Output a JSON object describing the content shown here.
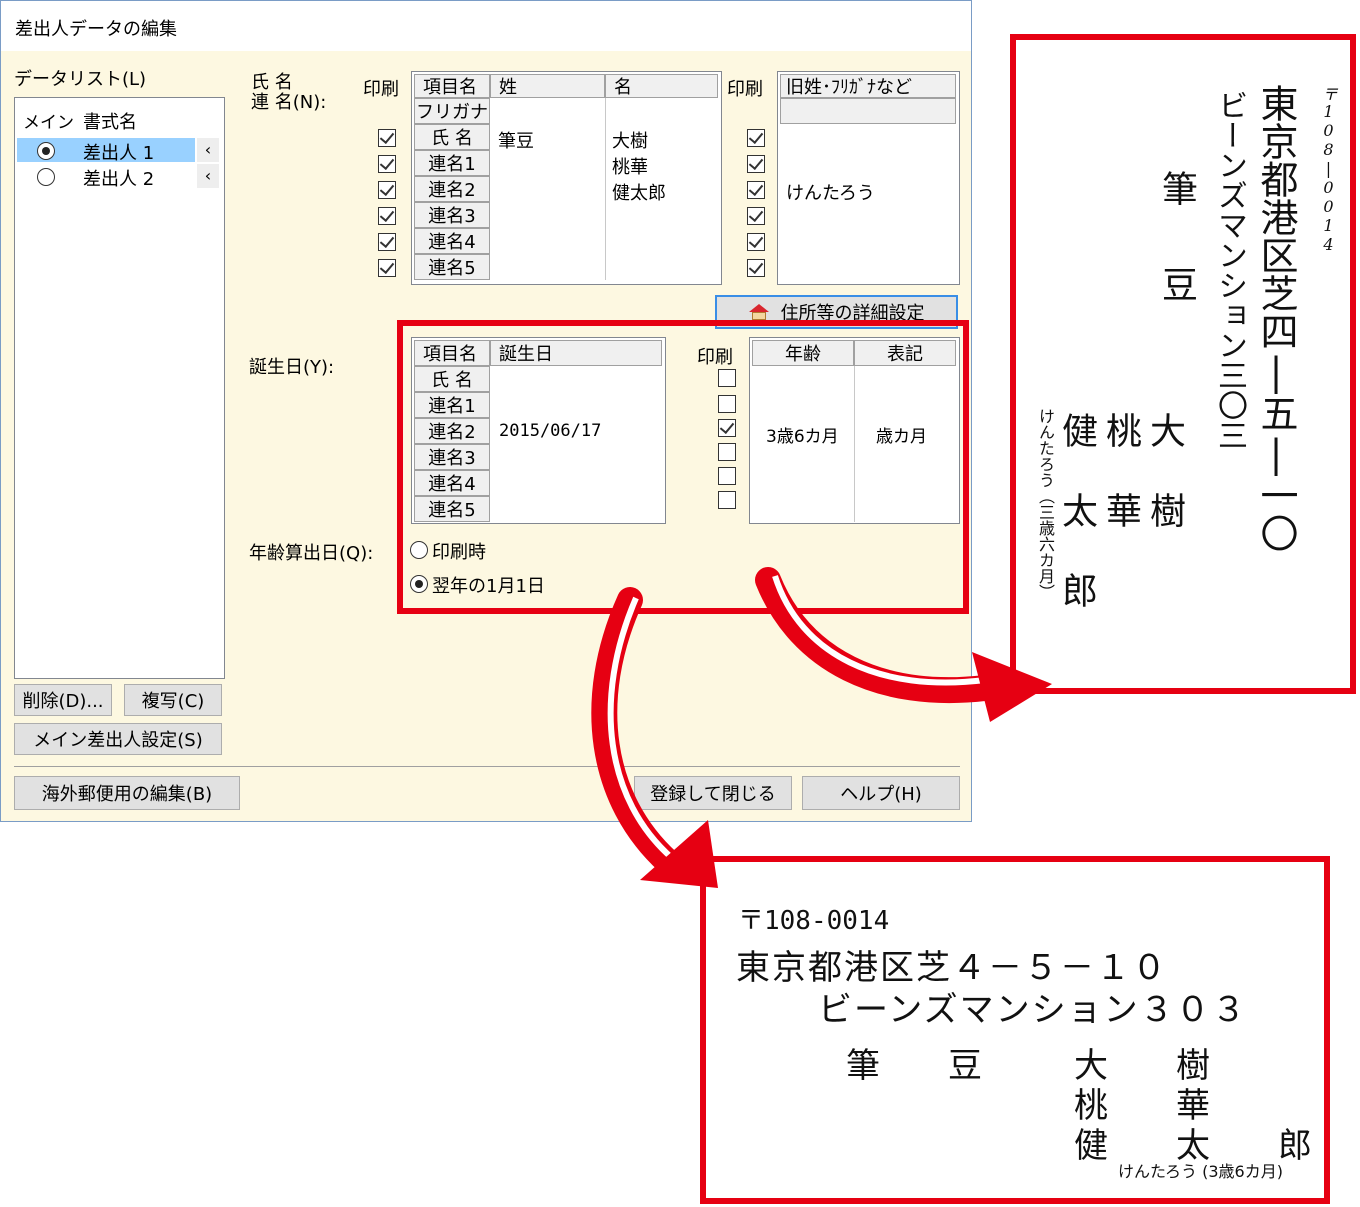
{
  "dialog": {
    "title": "差出人データの編集",
    "data_list_label": "データリスト(L)",
    "list": {
      "col_main": "メイン",
      "col_format": "書式名",
      "items": [
        {
          "name": "差出人 1",
          "selected": true
        },
        {
          "name": "差出人 2",
          "selected": false
        }
      ]
    },
    "buttons": {
      "delete": "削除(D)...",
      "copy": "複写(C)",
      "main_sender": "メイン差出人設定(S)",
      "overseas": "海外郵便用の編集(B)",
      "register_close": "登録して閉じる",
      "help": "ヘルプ(H)",
      "address_detail": "住所等の詳細設定"
    },
    "name_section": {
      "label_line1": "氏 名",
      "label_line2": "連 名(N):",
      "print_label": "印刷",
      "col_item": "項目名",
      "col_last": "姓",
      "col_first": "名",
      "furigana_row": "フリガナ",
      "rows": [
        {
          "item": "氏 名",
          "last": "筆豆",
          "first": "大樹",
          "print": true,
          "extra": ""
        },
        {
          "item": "連名1",
          "last": "",
          "first": "桃華",
          "print": true,
          "extra": ""
        },
        {
          "item": "連名2",
          "last": "",
          "first": "健太郎",
          "print": true,
          "extra": "けんたろう"
        },
        {
          "item": "連名3",
          "last": "",
          "first": "",
          "print": true,
          "extra": ""
        },
        {
          "item": "連名4",
          "last": "",
          "first": "",
          "print": true,
          "extra": ""
        },
        {
          "item": "連名5",
          "last": "",
          "first": "",
          "print": true,
          "extra": ""
        }
      ],
      "extra_print_label": "印刷",
      "extra_col": "旧姓･ﾌﾘｶﾞﾅなど"
    },
    "birthday_section": {
      "label": "誕生日(Y):",
      "col_item": "項目名",
      "col_birthday": "誕生日",
      "print_label": "印刷",
      "col_age": "年齢",
      "col_notation": "表記",
      "rows": [
        {
          "item": "氏 名",
          "birthday": "",
          "print": false,
          "age": "",
          "notation": ""
        },
        {
          "item": "連名1",
          "birthday": "",
          "print": false,
          "age": "",
          "notation": ""
        },
        {
          "item": "連名2",
          "birthday": "2015/06/17",
          "print": true,
          "age": "3歳6カ月",
          "notation": "歳カ月"
        },
        {
          "item": "連名3",
          "birthday": "",
          "print": false,
          "age": "",
          "notation": ""
        },
        {
          "item": "連名4",
          "birthday": "",
          "print": false,
          "age": "",
          "notation": ""
        },
        {
          "item": "連名5",
          "birthday": "",
          "print": false,
          "age": "",
          "notation": ""
        }
      ],
      "age_calc_label": "年齢算出日(Q):",
      "options": [
        {
          "label": "印刷時",
          "selected": false
        },
        {
          "label": "翌年の1月1日",
          "selected": true
        }
      ]
    }
  },
  "vertical_preview": {
    "postal": "〒108|0014",
    "address1": "東京都港区芝四|五|一〇",
    "address2": "ビーンズマンション三〇三",
    "surname1": "筆",
    "surname2": "豆",
    "name1": "大樹",
    "name2": "桃華",
    "name3": "健太郎",
    "ruby": "けんたろう（三歳六カ月）"
  },
  "horizontal_preview": {
    "postal": "〒108-0014",
    "address1": "東京都港区芝４－５－１０",
    "address2": "ビーンズマンション３０３",
    "surname": "筆　　豆",
    "name1": "大　　樹",
    "name2": "桃　　華",
    "name3": "健　　太　　郎",
    "ruby": "けんたろう (3歳6カ月)"
  },
  "colors": {
    "highlight": "#e60012",
    "selection": "#99d1ff",
    "dialog_bg": "#fdf8e1"
  }
}
